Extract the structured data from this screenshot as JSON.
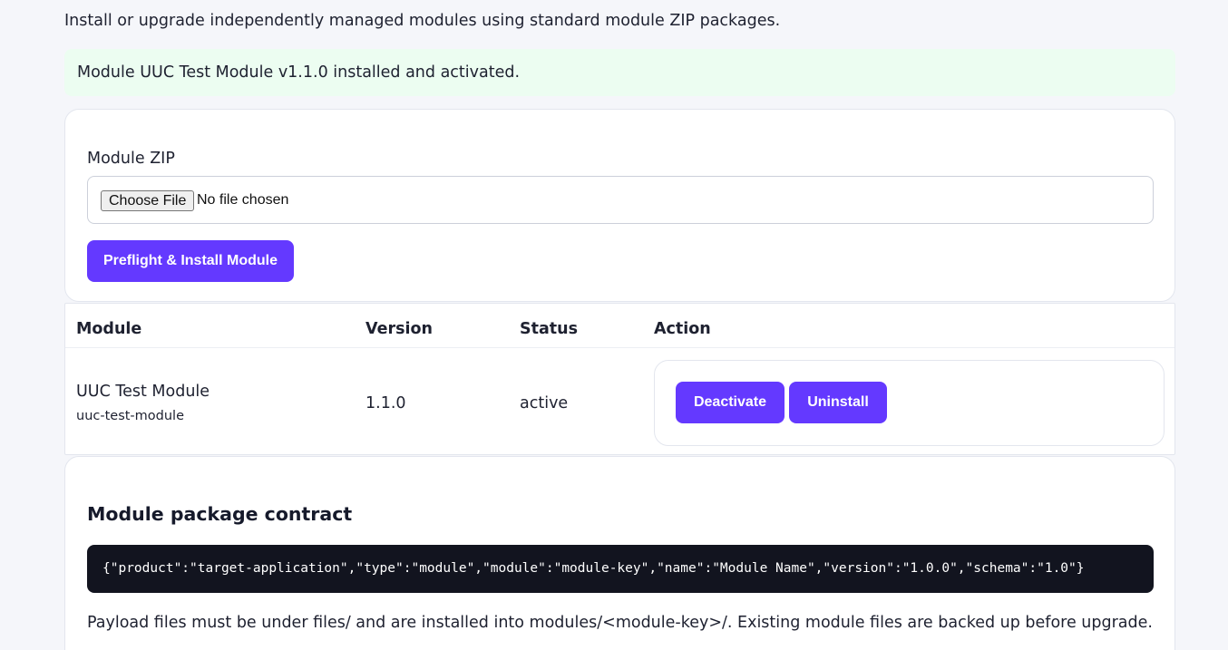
{
  "intro_text": "Install or upgrade independently managed modules using standard module ZIP packages.",
  "notice": {
    "message": "Module UUC Test Module v1.1.0 installed and activated.",
    "color": "#ecfdf1"
  },
  "upload": {
    "field_label": "Module ZIP",
    "choose_file_label": "Choose File",
    "file_status": "No file chosen",
    "submit_label": "Preflight & Install Module"
  },
  "modules_table": {
    "columns": [
      "Module",
      "Version",
      "Status",
      "Action"
    ],
    "rows": [
      {
        "name": "UUC Test Module",
        "key": "uuc-test-module",
        "version": "1.1.0",
        "status": "active",
        "actions": [
          "Deactivate",
          "Uninstall"
        ]
      }
    ]
  },
  "contract": {
    "title": "Module package contract",
    "manifest_example": "{\"product\":\"target-application\",\"type\":\"module\",\"module\":\"module-key\",\"name\":\"Module Name\",\"version\":\"1.0.0\",\"schema\":\"1.0\"}",
    "note": "Payload files must be under files/ and are installed into modules/<module-key>/. Existing module files are backed up before upgrade."
  },
  "colors": {
    "accent": "#6439ff",
    "page_background": "#f5f6fa",
    "code_background": "#12141f"
  }
}
